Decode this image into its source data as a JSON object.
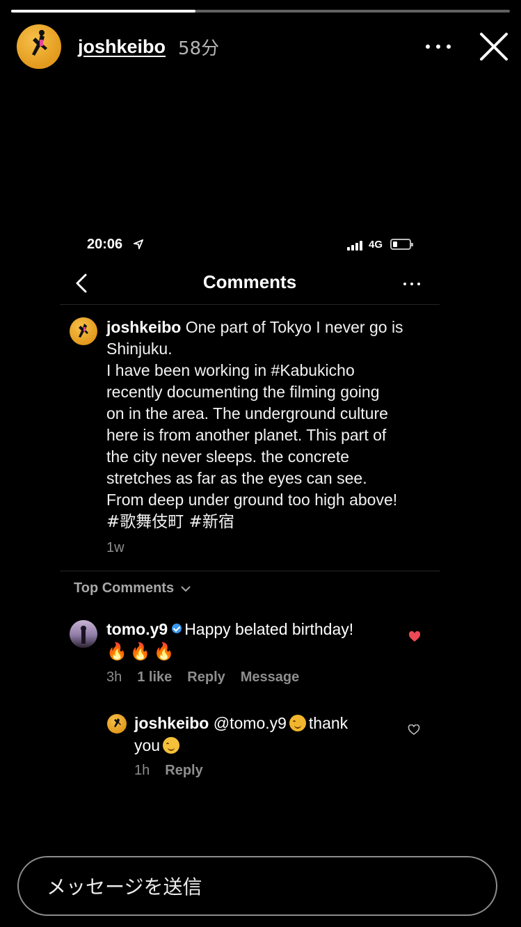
{
  "story": {
    "username": "joshkeibo",
    "time_ago": "58分",
    "progress": 0.37
  },
  "inner_screen": {
    "status_time": "20:06",
    "network": "4G",
    "title": "Comments",
    "caption": {
      "username": "joshkeibo",
      "lines": [
        "One part of Tokyo I never go is",
        "Shinjuku.",
        "I have been working in #Kabukicho",
        "recently documenting the filming going",
        "on in the area. The underground culture",
        "here is from another planet. This part of",
        "the city never sleeps. the concrete",
        "stretches as far as the eyes can see.",
        "From deep under ground too high above!",
        "#歌舞伎町 #新宿"
      ],
      "time": "1w"
    },
    "top_comments_label": "Top Comments",
    "comment": {
      "username": "tomo.y9",
      "text": "Happy belated birthday!",
      "emojis": "🔥🔥🔥",
      "time": "3h",
      "likes": "1 like",
      "reply_label": "Reply",
      "message_label": "Message"
    },
    "reply": {
      "username": "joshkeibo",
      "mention": "@tomo.y9",
      "text_1": "thank",
      "text_2": "you",
      "time": "1h",
      "reply_label": "Reply"
    }
  },
  "message_bar": {
    "placeholder": "メッセージを送信"
  },
  "colors": {
    "background": "#000000",
    "muted_text": "#8e8e8e",
    "verified_blue": "#3897f0",
    "like_red": "#ed4956",
    "avatar_orange": "#e39a1d"
  }
}
